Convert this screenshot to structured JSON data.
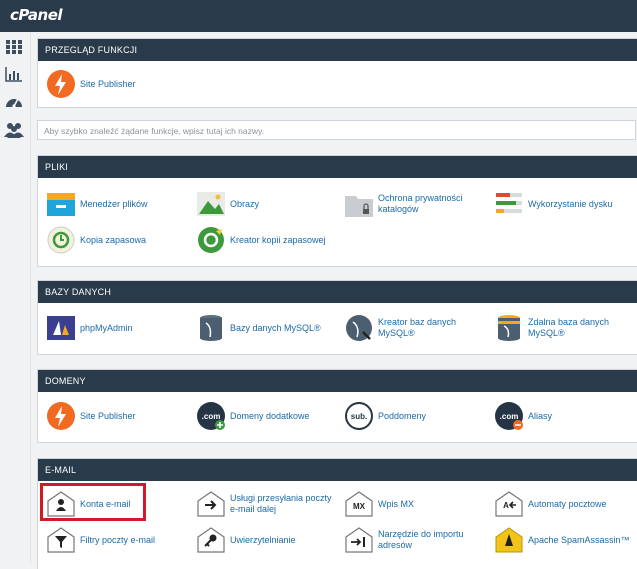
{
  "brand": "cPanel",
  "sidebar": [
    "home-grid-icon",
    "stats-icon",
    "dashboard-icon",
    "users-icon"
  ],
  "search": {
    "placeholder": "Aby szybko znaleźć żądane funkcje, wpisz tutaj ich nazwy."
  },
  "sections": {
    "overview": {
      "title": "PRZEGLĄD FUNKCJI",
      "items": [
        "Site Publisher"
      ]
    },
    "files": {
      "title": "PLIKI",
      "items": [
        "Menedżer plików",
        "Obrazy",
        "Ochrona prywatności katalogów",
        "Wykorzystanie dysku",
        "Kopia zapasowa",
        "Kreator kopii zapasowej"
      ]
    },
    "databases": {
      "title": "BAZY DANYCH",
      "items": [
        "phpMyAdmin",
        "Bazy danych MySQL®",
        "Kreator baz danych MySQL®",
        "Zdalna baza danych MySQL®"
      ]
    },
    "domains": {
      "title": "DOMENY",
      "items": [
        "Site Publisher",
        "Domeny dodatkowe",
        "Poddomeny",
        "Aliasy"
      ]
    },
    "email": {
      "title": "E-MAIL",
      "items": [
        "Konta e-mail",
        "Usługi przesyłania poczty e-mail dalej",
        "Wpis MX",
        "Automaty pocztowe",
        "Filtry poczty e-mail",
        "Uwierzytelnianie",
        "Narzędzie do importu adresów",
        "Apache SpamAssassin™"
      ]
    }
  },
  "icon_text": {
    "com": ".com",
    "sub": "sub.",
    "mx": "MX"
  },
  "colors": {
    "header": "#293a4a",
    "link": "#1b6aa8",
    "highlight": "#d11a26",
    "orange": "#f26a21"
  }
}
